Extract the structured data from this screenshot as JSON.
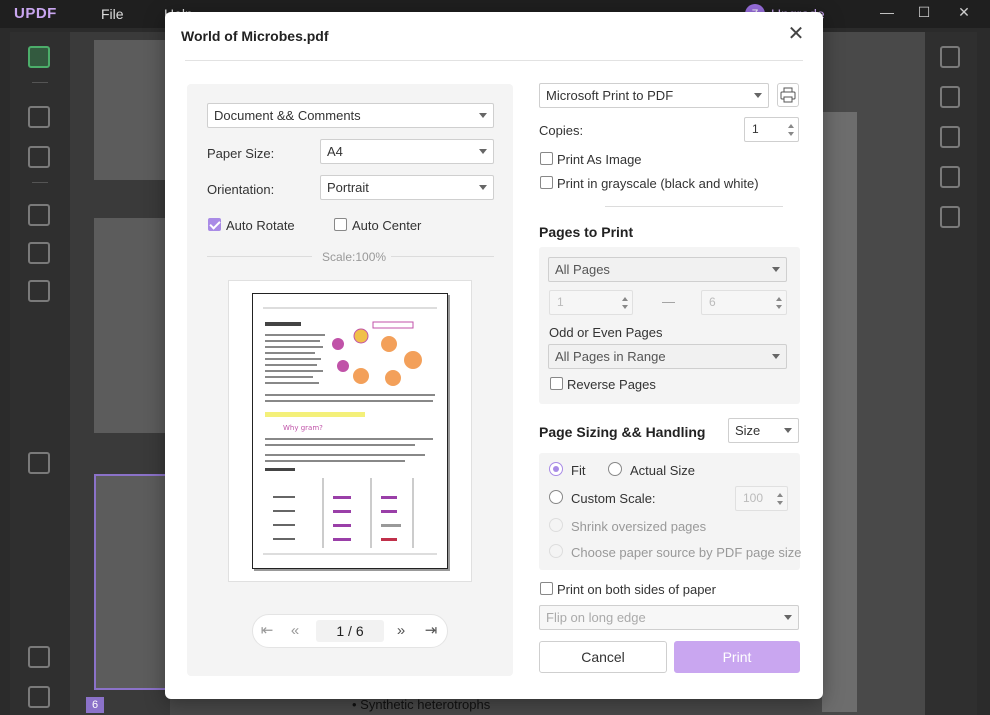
{
  "app": {
    "brand": "UPDF",
    "menu": {
      "file": "File",
      "help": "Help"
    },
    "user_initial": "Z",
    "upgrade": "Upgrade",
    "window": {
      "minimize": "—",
      "maximize": "☐",
      "close": "✕"
    },
    "current_page_badge": "6",
    "doc_bottom_text": "• Synthetic heterotrophs",
    "accent": "#c9a6f0"
  },
  "dialog": {
    "title": "World of Microbes.pdf",
    "close_label": "✕",
    "left": {
      "content_select": "Document && Comments",
      "paper_size_label": "Paper Size:",
      "paper_size": "A4",
      "orientation_label": "Orientation:",
      "orientation": "Portrait",
      "auto_rotate": {
        "label": "Auto Rotate",
        "checked": true
      },
      "auto_center": {
        "label": "Auto Center",
        "checked": false
      },
      "scale_label": "Scale:100%",
      "pager": {
        "current": "1",
        "separator": "/",
        "total": "6"
      }
    },
    "right": {
      "printer": "Microsoft Print to PDF",
      "copies_label": "Copies:",
      "copies": "1",
      "print_as_image": {
        "label": "Print As Image",
        "checked": false
      },
      "grayscale": {
        "label": "Print in grayscale (black and white)",
        "checked": false
      },
      "pages_to_print": {
        "heading": "Pages to Print",
        "range_select": "All Pages",
        "from": "1",
        "dash": "—",
        "to": "6",
        "odd_even_label": "Odd or Even Pages",
        "odd_even_select": "All Pages in Range",
        "reverse": {
          "label": "Reverse Pages",
          "checked": false
        }
      },
      "sizing": {
        "heading": "Page Sizing && Handling",
        "mode_select": "Size",
        "fit": "Fit",
        "actual_size": "Actual Size",
        "custom_scale": "Custom Scale:",
        "custom_scale_value": "100",
        "shrink": "Shrink oversized pages",
        "paper_source": "Choose paper source by PDF page size",
        "selected": "Fit"
      },
      "both_sides": {
        "label": "Print on both sides of paper",
        "checked": false
      },
      "flip_select": "Flip on long edge",
      "cancel_label": "Cancel",
      "print_label": "Print"
    }
  }
}
